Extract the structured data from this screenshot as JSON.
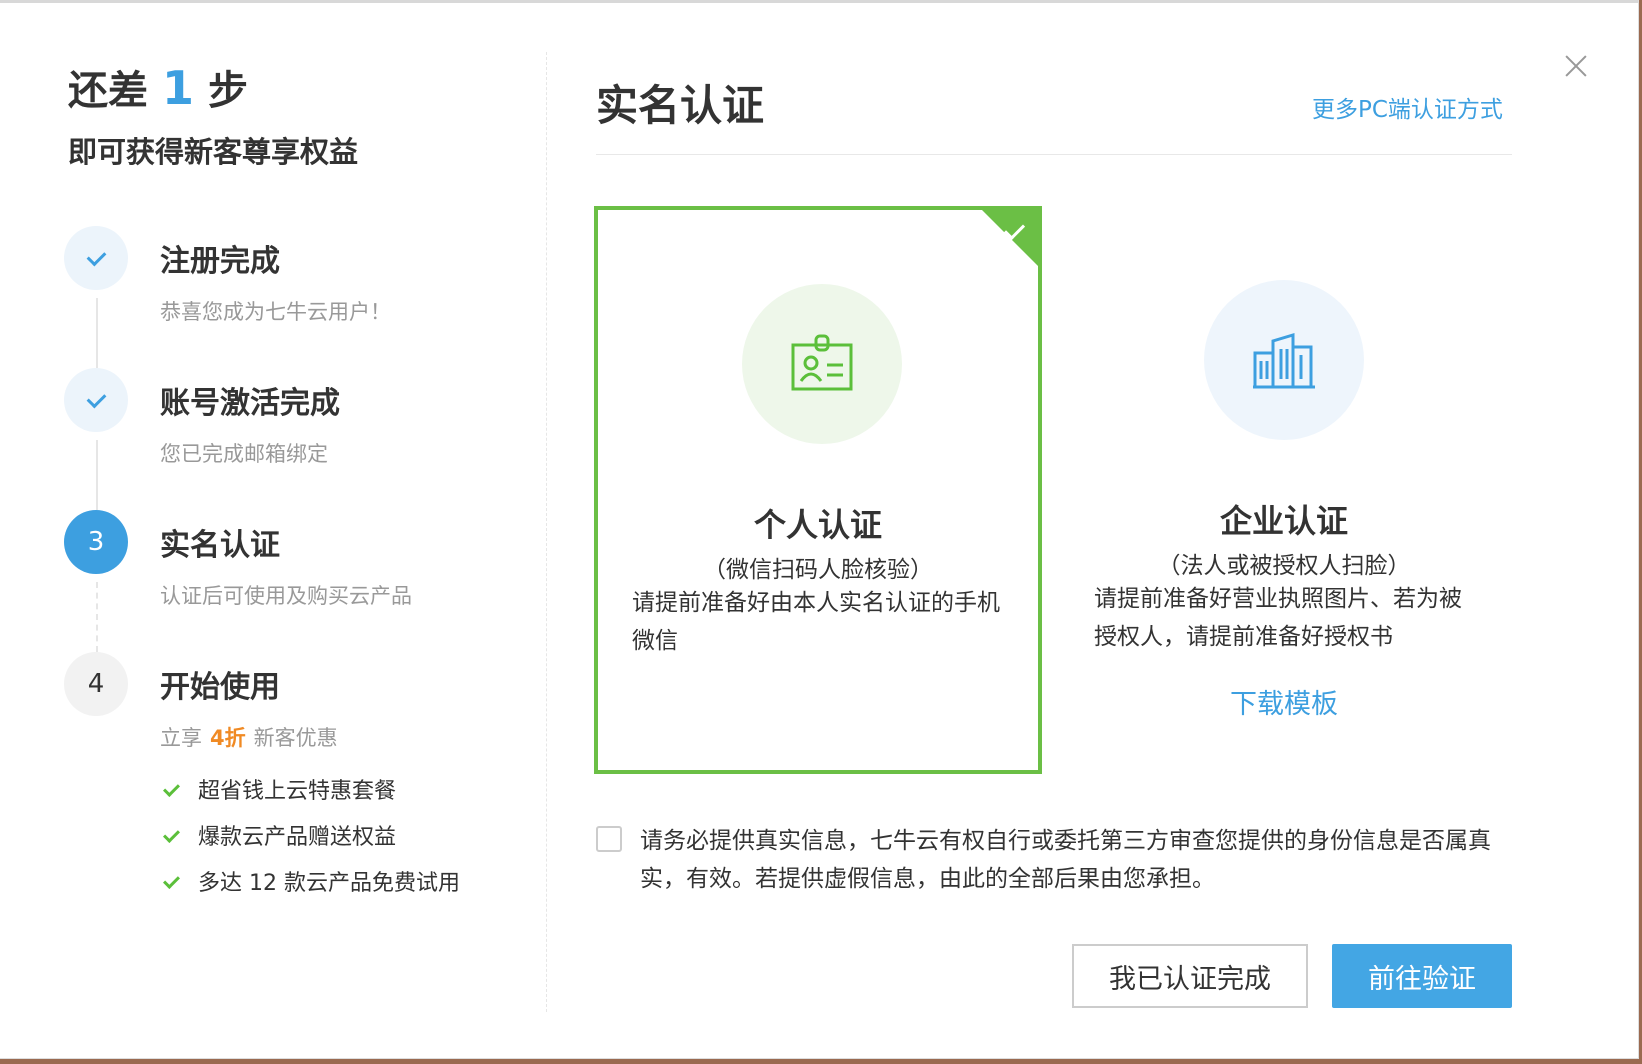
{
  "modal": {
    "close_icon": "close-icon"
  },
  "left": {
    "headline_prefix": "还差",
    "headline_num": "1",
    "headline_suffix": "步",
    "subhead": "即可获得新客尊享权益",
    "steps": [
      {
        "marker": "",
        "state": "done",
        "title": "注册完成",
        "desc": "恭喜您成为七牛云用户！"
      },
      {
        "marker": "",
        "state": "done",
        "title": "账号激活完成",
        "desc": "您已完成邮箱绑定"
      },
      {
        "marker": "3",
        "state": "active",
        "title": "实名认证",
        "desc": "认证后可使用及购买云产品"
      },
      {
        "marker": "4",
        "state": "pending",
        "title": "开始使用",
        "desc_prefix": "立享",
        "desc_highlight": "4折",
        "desc_suffix": "新客优惠"
      }
    ],
    "benefits": [
      "超省钱上云特惠套餐",
      "爆款云产品赠送权益",
      "多达 12 款云产品免费试用"
    ]
  },
  "right": {
    "title": "实名认证",
    "more_link": "更多PC端认证方式",
    "cards": [
      {
        "title": "个人认证",
        "subtitle": "（微信扫码人脸核验）",
        "desc": "请提前准备好由本人实名认证的手机微信",
        "selected": true,
        "icon": "id-card-icon"
      },
      {
        "title": "企业认证",
        "subtitle": "（法人或被授权人扫脸）",
        "desc": "请提前准备好营业执照图片、若为被授权人，请提前准备好授权书",
        "download_label": "下载模板",
        "selected": false,
        "icon": "building-icon"
      }
    ],
    "agreement": "请务必提供真实信息，七牛云有权自行或委托第三方审查您提供的身份信息是否属真实，有效。若提供虚假信息，由此的全部后果由您承担。",
    "agreement_checked": false,
    "buttons": {
      "done_label": "我已认证完成",
      "go_label": "前往验证"
    }
  },
  "colors": {
    "accent_blue": "#3d9fe0",
    "accent_green": "#6bbf45",
    "highlight_orange": "#f08a24"
  }
}
